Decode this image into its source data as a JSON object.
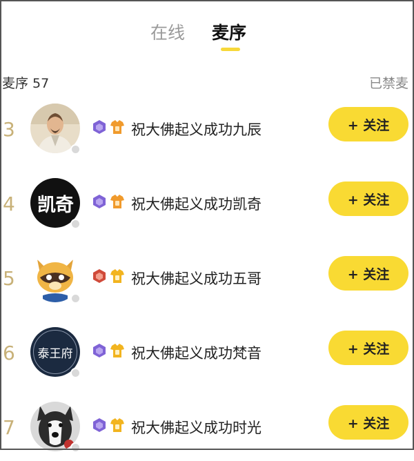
{
  "tabs": [
    {
      "label": "在线",
      "active": false
    },
    {
      "label": "麦序",
      "active": true
    }
  ],
  "header": {
    "queue_count": "麦序 57",
    "mic_status": "已禁麦"
  },
  "colors": {
    "accent_yellow": "#f9da33",
    "rank_gold": "#c8b178",
    "level_purple": "#7f63d6",
    "level_red": "#d04a3a",
    "noble_orange": "#f09a2c",
    "noble_gold": "#f2b41f"
  },
  "users": [
    {
      "rank": "3",
      "name": "祝大佛起义成功九辰",
      "avatar": "man-avatar",
      "level_badge": "purple",
      "noble_badge": "orange",
      "follow_label": "+ 关注"
    },
    {
      "rank": "4",
      "name": "祝大佛起义成功凯奇",
      "avatar": "text-logo-avatar",
      "avatar_text": "凯奇",
      "level_badge": "purple",
      "noble_badge": "orange",
      "follow_label": "+ 关注"
    },
    {
      "rank": "5",
      "name": "祝大佛起义成功五哥",
      "avatar": "raccoon-avatar",
      "level_badge": "red",
      "noble_badge": "gold",
      "follow_label": "+ 关注"
    },
    {
      "rank": "6",
      "name": "祝大佛起义成功梵音",
      "avatar": "badge-logo-avatar",
      "avatar_text": "泰王府",
      "level_badge": "purple",
      "noble_badge": "gold",
      "follow_label": "+ 关注"
    },
    {
      "rank": "7",
      "name": "祝大佛起义成功时光",
      "avatar": "husky-avatar",
      "level_badge": "purple",
      "noble_badge": "gold",
      "follow_label": "+ 关注"
    }
  ]
}
